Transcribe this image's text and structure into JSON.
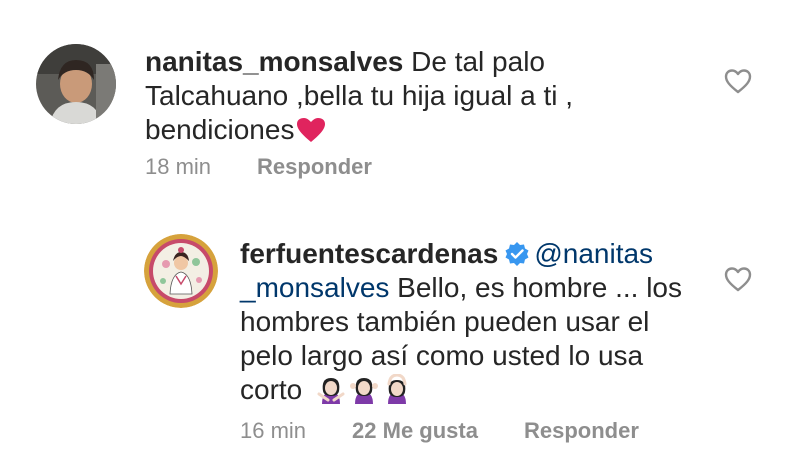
{
  "comments": [
    {
      "username": "nanitas_monsalves",
      "text_line1": "De tal palo",
      "text_line2": "Talcahuano ,bella tu hija igual a ti ,",
      "text_line3": "bendiciones",
      "emoji": "red-heart",
      "time": "18 min",
      "reply_label": "Responder",
      "like_icon": "heart-outline-icon"
    },
    {
      "username": "ferfuentescardenas",
      "verified": true,
      "mention_part1": "@nanitas",
      "mention_part2": "_monsalves",
      "text_line2_rest": " Bello, es hombre ... los",
      "text_line3": "hombres también pueden usar el",
      "text_line4": "pelo largo así como usted lo usa",
      "text_line5": "corto",
      "emojis": [
        "woman-gesturing-no",
        "woman-shrugging",
        "woman-gesturing-ok"
      ],
      "time": "16 min",
      "likes_label": "22 Me gusta",
      "reply_label": "Responder",
      "like_icon": "heart-outline-icon"
    }
  ],
  "colors": {
    "text": "#262626",
    "meta": "#8e8e8e",
    "mention": "#00376b",
    "verified": "#3897f0",
    "heart_emoji": "#e0245e"
  }
}
